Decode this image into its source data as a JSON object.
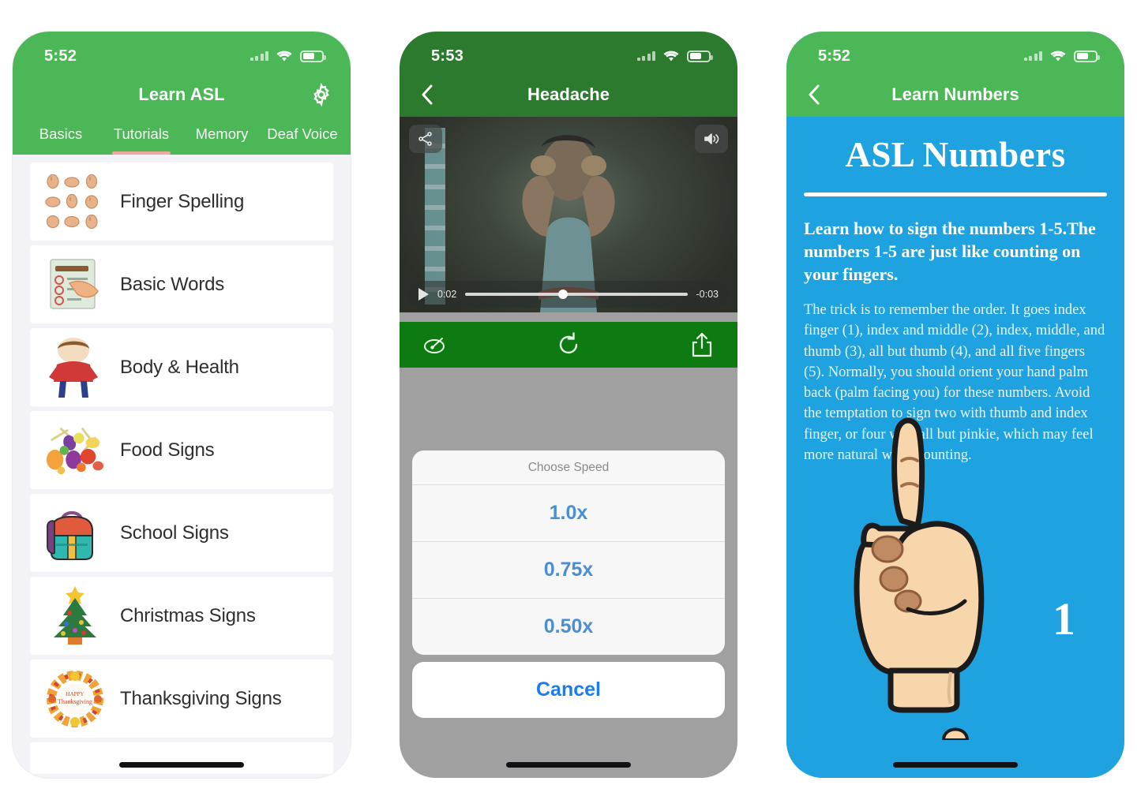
{
  "screens": [
    {
      "status": {
        "time": "5:52",
        "signal_icon": "signal-bars-icon",
        "wifi_icon": "wifi-icon",
        "battery_icon": "battery-icon"
      },
      "nav": {
        "title": "Learn ASL",
        "settings_icon": "gear-icon"
      },
      "tabs": [
        {
          "label": "Basics",
          "active": false
        },
        {
          "label": "Tutorials",
          "active": true
        },
        {
          "label": "Memory",
          "active": false
        },
        {
          "label": "Deaf Voice",
          "active": false
        }
      ],
      "list": [
        {
          "label": "Finger Spelling",
          "icon": "hand-signs-icon"
        },
        {
          "label": "Basic Words",
          "icon": "checklist-icon"
        },
        {
          "label": "Body & Health",
          "icon": "person-icon"
        },
        {
          "label": "Food Signs",
          "icon": "food-icon"
        },
        {
          "label": "School Signs",
          "icon": "backpack-icon"
        },
        {
          "label": "Christmas Signs",
          "icon": "christmas-tree-icon"
        },
        {
          "label": "Thanksgiving Signs",
          "icon": "thanksgiving-wreath-icon"
        }
      ]
    },
    {
      "status": {
        "time": "5:53"
      },
      "nav": {
        "title": "Headache",
        "back_icon": "chevron-left-icon"
      },
      "video": {
        "share_icon": "airplay-share-icon",
        "volume_icon": "volume-icon",
        "play_icon": "play-icon",
        "elapsed": "0:02",
        "remaining": "-0:03",
        "progress_percent": 44
      },
      "toolbar": {
        "speed_icon": "speed-gauge-icon",
        "replay_icon": "replay-icon",
        "share_icon": "share-export-icon"
      },
      "action_sheet": {
        "title": "Choose Speed",
        "options": [
          "1.0x",
          "0.75x",
          "0.50x"
        ],
        "cancel": "Cancel"
      }
    },
    {
      "status": {
        "time": "5:52"
      },
      "nav": {
        "title": "Learn Numbers",
        "back_icon": "chevron-left-icon"
      },
      "content": {
        "heading": "ASL Numbers",
        "lead": "Learn how to sign the numbers 1-5.The numbers 1-5 are just like counting on your fingers.",
        "body": "The trick is to remember the order. It goes index finger (1), index and middle (2), index, middle, and thumb (3), all but thumb (4), and all five fingers (5). Normally, you should orient your hand palm back (palm facing you) for these numbers. Avoid the temptation to sign two with thumb and index finger, or four with all but pinkie, which may feel more natural when counting.",
        "numeral": "1",
        "hand_icon": "hand-number-one-icon"
      }
    }
  ],
  "colors": {
    "green_header": "#4cb756",
    "dark_green_header": "#2b7a2e",
    "toolbar_green": "#0e7a12",
    "blue_page": "#1fa2e0",
    "tab_underline": "#f0a9a1",
    "action_blue": "#1b7bf0",
    "list_bg": "#f2f2f7"
  }
}
